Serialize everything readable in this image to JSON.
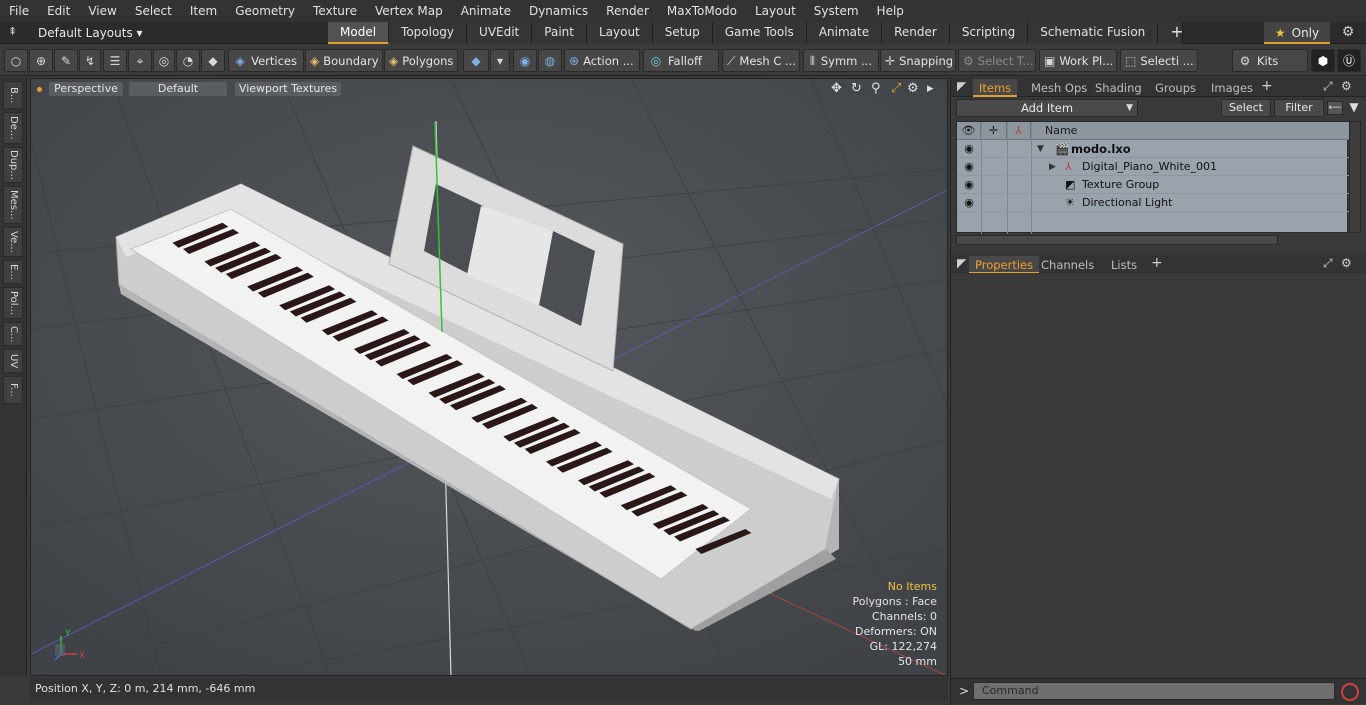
{
  "menu": [
    "File",
    "Edit",
    "View",
    "Select",
    "Item",
    "Geometry",
    "Texture",
    "Vertex Map",
    "Animate",
    "Dynamics",
    "Render",
    "MaxToModo",
    "Layout",
    "System",
    "Help"
  ],
  "layout": {
    "selector": "Default Layouts ▾",
    "tabs": [
      "Model",
      "Topology",
      "UVEdit",
      "Paint",
      "Layout",
      "Setup",
      "Game Tools",
      "Animate",
      "Render",
      "Scripting",
      "Schematic Fusion"
    ],
    "active_tab": "Model",
    "add_tab": "+",
    "only_label": "Only"
  },
  "toolbar": {
    "vertices": "Vertices",
    "boundary": "Boundary",
    "polygons": "Polygons",
    "action": "Action ...",
    "falloff": "Falloff",
    "mesh": "Mesh C ...",
    "symm": "Symm ...",
    "snapping": "Snapping",
    "select_t": "Select T...",
    "work_pl": "Work Pl...",
    "selecti": "Selecti ...",
    "kits": "Kits"
  },
  "left_tabs": [
    "B...",
    "De...",
    "Dup...",
    "Mes...",
    "Ve...",
    "E...",
    "Pol...",
    "C...",
    "UV",
    "F..."
  ],
  "viewport": {
    "view_mode": "Perspective",
    "shading": "Default",
    "textures": "Viewport Textures",
    "info": {
      "no_items": "No Items",
      "polygons": "Polygons : Face",
      "channels": "Channels: 0",
      "deformers": "Deformers: ON",
      "gl": "GL: 122,274",
      "scale": "50 mm"
    },
    "axis_labels": {
      "x": "X",
      "y": "Y",
      "z": "Z"
    }
  },
  "status": {
    "position": "Position X, Y, Z:   0 m, 214 mm, -646 mm"
  },
  "items_panel": {
    "tabs": [
      "Items",
      "Mesh Ops",
      "Shading",
      "Groups",
      "Images"
    ],
    "active_tab": "Items",
    "add_item": "Add Item",
    "select": "Select",
    "filter": "Filter",
    "column_name": "Name",
    "rows": [
      {
        "name": "modo.lxo",
        "level": 0
      },
      {
        "name": "Digital_Piano_White_001",
        "level": 1
      },
      {
        "name": "Texture Group",
        "level": 1
      },
      {
        "name": "Directional Light",
        "level": 1
      }
    ]
  },
  "props_panel": {
    "tabs": [
      "Properties",
      "Channels",
      "Lists"
    ],
    "active_tab": "Properties"
  },
  "command": {
    "prompt": ">",
    "placeholder": "Command"
  },
  "colors": {
    "accent": "#e0a030",
    "viewport_bg": "#484b4f",
    "list_bg": "#9aa3ab"
  }
}
